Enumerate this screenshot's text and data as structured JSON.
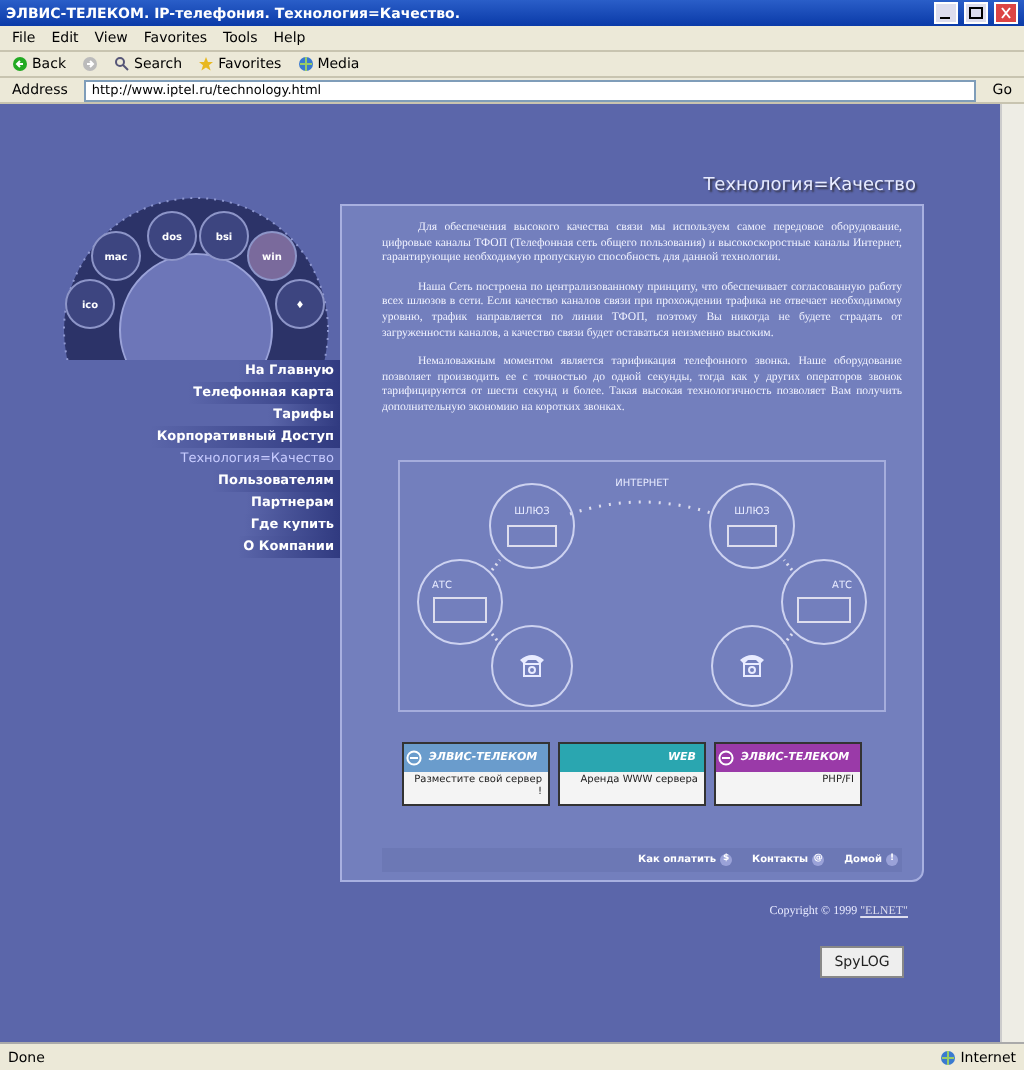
{
  "window": {
    "title": "ЭЛВИС-ТЕЛЕКОМ. IP-телефония. Технология=Качество."
  },
  "menu_bar": [
    "File",
    "Edit",
    "View",
    "Favorites",
    "Tools",
    "Help"
  ],
  "toolbar": [
    {
      "kind": "back",
      "label": "Back"
    },
    {
      "kind": "forward"
    },
    {
      "kind": "search",
      "label": "Search"
    },
    {
      "kind": "favorites",
      "label": "Favorites"
    },
    {
      "kind": "media",
      "label": "Media"
    }
  ],
  "address_bar": {
    "label": "Address",
    "value": "http://www.iptel.ru/technology.html",
    "go": "Go"
  },
  "page": {
    "wheel": [
      {
        "label": "ico",
        "selected": false
      },
      {
        "label": "mac",
        "selected": false
      },
      {
        "label": "dos",
        "selected": false
      },
      {
        "label": "bsi",
        "selected": false
      },
      {
        "label": "win",
        "selected": true
      },
      {
        "label": "♦",
        "selected": false
      }
    ],
    "nav": [
      {
        "label": "На Главную",
        "selected": false
      },
      {
        "label": "Телефонная карта",
        "selected": false
      },
      {
        "label": "Тарифы",
        "selected": false
      },
      {
        "label": "Корпоративный Доступ",
        "selected": false
      },
      {
        "label": "Технология=Качество",
        "selected": true
      },
      {
        "label": "Пользователям",
        "selected": false
      },
      {
        "label": "Партнерам",
        "selected": false
      },
      {
        "label": "Где купить",
        "selected": false
      },
      {
        "label": "О Компании",
        "selected": false
      }
    ],
    "heading": "Технология=Качество",
    "paragraphs": [
      "Для обеспечения высокого качества связи мы используем самое передовое оборудование, цифровые каналы ТФОП (Телефонная сеть общего пользования) и высокоскоростные каналы Интернет, гарантирующие необходимую пропускную способность для данной технологии.",
      "Наша Сеть построена по централизованному принципу, что обеспечивает согласованную работу всех шлюзов в сети. Если качество каналов связи при прохождении трафика не отвечает необходимому уровню, трафик направляется по линии ТФОП, поэтому Вы никогда не будете страдать от загруженности каналов, а качество связи будет оставаться неизменно высоким.",
      "Немаловажным моментом является тарификация телефонного звонка. Наше оборудование позволяет производить ее с точностью до одной секунды, тогда как у других операторов звонок тарифицируются от шести секунд и более. Такая высокая технологичность позволяет Вам получить дополнительную экономию на коротких звонках."
    ],
    "diagram": {
      "internet": "ИНТЕРНЕТ",
      "gateway_left": "ШЛЮЗ",
      "gateway_right": "ШЛЮЗ",
      "exchange_left": "АТС",
      "exchange_right": "АТС"
    },
    "banners": [
      {
        "kind": "elvis",
        "brand": "ЭЛВИС-ТЕЛЕКОМ",
        "caption": "Разместите свой сервер !",
        "color": "#6a9ccc"
      },
      {
        "kind": "web",
        "brand": "WEB",
        "caption": "Аренда WWW сервера",
        "color": "#2aa6b0"
      },
      {
        "kind": "elvis",
        "brand": "ЭЛВИС-ТЕЛЕКОМ",
        "caption": "PHP/FI",
        "color": "#9a3aa8"
      }
    ],
    "footer_links": [
      {
        "label": "Как оплатить",
        "icon": "$"
      },
      {
        "label": "Контакты",
        "icon": "@"
      },
      {
        "label": "Домой",
        "icon": "!"
      }
    ],
    "copyright": "Copyright © 1999 ",
    "copyright_link": "\"ELNET\"",
    "counter": {
      "brand": "SpyLOG"
    }
  },
  "status_bar": {
    "text": "Done",
    "zone": "Internet"
  }
}
